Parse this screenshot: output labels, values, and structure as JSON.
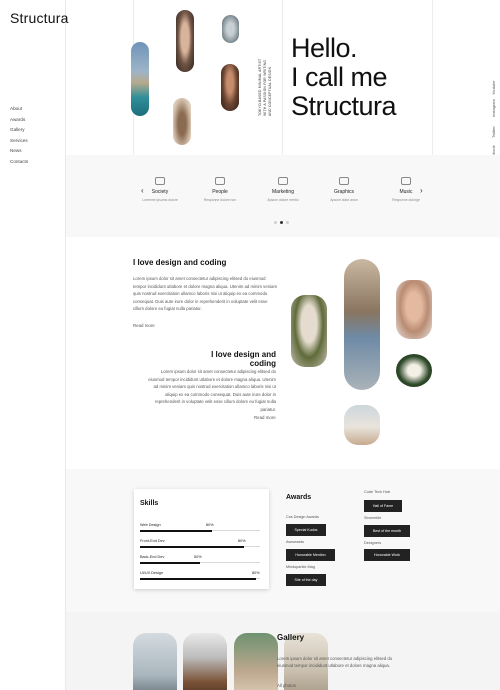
{
  "brand": {
    "logo": "Structura"
  },
  "nav": [
    "About",
    "Awards",
    "Gallery",
    "Services",
    "News",
    "Contacts"
  ],
  "hero": {
    "title_lines": [
      "Hello.",
      "I call me",
      "Structura"
    ],
    "caption": "TOKYO-BASED MINIMAL ARTIST WITH A PASSION FOR WRITING AND CONCEPTUAL DESIGN",
    "social": [
      "Youtube",
      "Instagram",
      "Twitter",
      "Facebook"
    ]
  },
  "services": {
    "prev_arrow": "‹",
    "next_arrow": "›",
    "items": [
      {
        "name": "Society",
        "desc": "Loremne ipsumo dolore"
      },
      {
        "name": "People",
        "desc": "Responne dolore non"
      },
      {
        "name": "Marketing",
        "desc": "Apsum dolore mertio"
      },
      {
        "name": "Graphics",
        "desc": "Apsum dolor anun"
      },
      {
        "name": "Music",
        "desc": "Responne dolorge"
      }
    ],
    "active_dot": 1,
    "dot_count": 3
  },
  "about": {
    "block1": {
      "heading": "I love design and coding",
      "text": "Lorem ipsum dolor sit amet consectetur adipiscing elitsed do eiusmod tempor incididunt utlabore et dolore magna aliqua. Utenim ad minim veniam quis nostrud exercitation ullamco laboris nisi ut aliquip ex ea commodo consequat. Duis aute irure dolor in reprehenderit in voluptate velit esse cillum dolore eu fugiat nulla pariatur.",
      "read_more": "Read more"
    },
    "block2": {
      "heading": "I love design and coding",
      "text": "Lorem ipsum dolor sit amet consectetur adipiscing elitsed do eiusmod tempor incididunt utlabore et dolore magna aliqua. Utenim ad minim veniam quis nostrud exercitation ullamco laboris nisi ut aliquip ex ea commodo consequat. Duis aute irure dolor in reprehenderit in voluptate velit esse cillum dolore eu fugiat nulla pariatur.",
      "read_more": "Read more"
    }
  },
  "skills": {
    "title": "Skills",
    "items": [
      {
        "label": "Web Design",
        "pct_label": "80%",
        "value": 0.6
      },
      {
        "label": "Front-End Dev",
        "pct_label": "80%",
        "value": 0.87
      },
      {
        "label": "Back-End Dev",
        "pct_label": "50%",
        "value": 0.5
      },
      {
        "label": "UI/UX Design",
        "pct_label": "80%",
        "value": 0.97
      }
    ]
  },
  "awards": {
    "title": "Awards",
    "col1": [
      {
        "label": "Css Design Awards",
        "button": "Special Kudos"
      },
      {
        "label": "Awwwards",
        "button": "Honorable Mention"
      },
      {
        "label": "Mindsparkle Mag",
        "button": "Site of the day"
      }
    ],
    "col2": [
      {
        "label": "Code Tech Hub",
        "button": "Hall of Fame"
      },
      {
        "label": "Strunmble",
        "button": "Best of the month"
      },
      {
        "label": "Designers",
        "button": "Honorable Work"
      }
    ]
  },
  "gallery": {
    "title": "Gallery",
    "text": "Lorem ipsum dolor sit amet consectetur adipiscing elitsed do eiusmod tempor incididunt utlabore et dolore magna aliqua.",
    "link": "All photos"
  }
}
